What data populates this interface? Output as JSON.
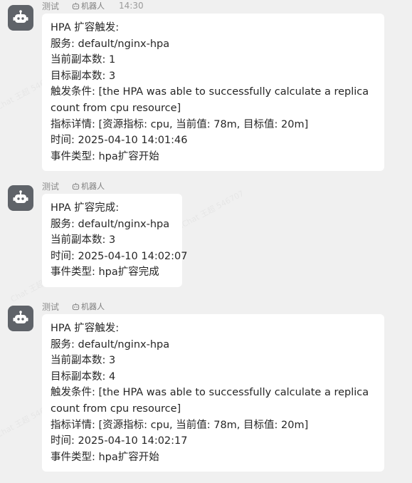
{
  "messages": [
    {
      "sender": "测试",
      "badge": "机器人",
      "time": "14:30",
      "lines": [
        "HPA 扩容触发:",
        "服务: default/nginx-hpa",
        "当前副本数: 1",
        "目标副本数: 3",
        "触发条件: [the HPA was able to successfully calculate a replica count from cpu resource]",
        "指标详情: [资源指标: cpu, 当前值: 78m, 目标值: 20m]",
        "时间: 2025-04-10 14:01:46",
        "事件类型: hpa扩容开始"
      ]
    },
    {
      "sender": "测试",
      "badge": "机器人",
      "time": "",
      "lines": [
        "HPA 扩容完成:",
        "服务: default/nginx-hpa",
        "当前副本数: 3",
        "时间: 2025-04-10 14:02:07",
        "事件类型: hpa扩容完成"
      ]
    },
    {
      "sender": "测试",
      "badge": "机器人",
      "time": "",
      "lines": [
        "HPA 扩容触发:",
        "服务: default/nginx-hpa",
        "当前副本数: 3",
        "目标副本数: 4",
        "触发条件: [the HPA was able to successfully calculate a replica count from cpu resource]",
        "指标详情: [资源指标: cpu, 当前值: 78m, 目标值: 20m]",
        "时间: 2025-04-10 14:02:17",
        "事件类型: hpa扩容开始"
      ]
    }
  ],
  "icons": {
    "avatar": "robot-icon",
    "badge": "robot-icon"
  },
  "colors": {
    "background": "#f0f0f0",
    "bubble": "#ffffff",
    "avatar": "#5f6369"
  }
}
